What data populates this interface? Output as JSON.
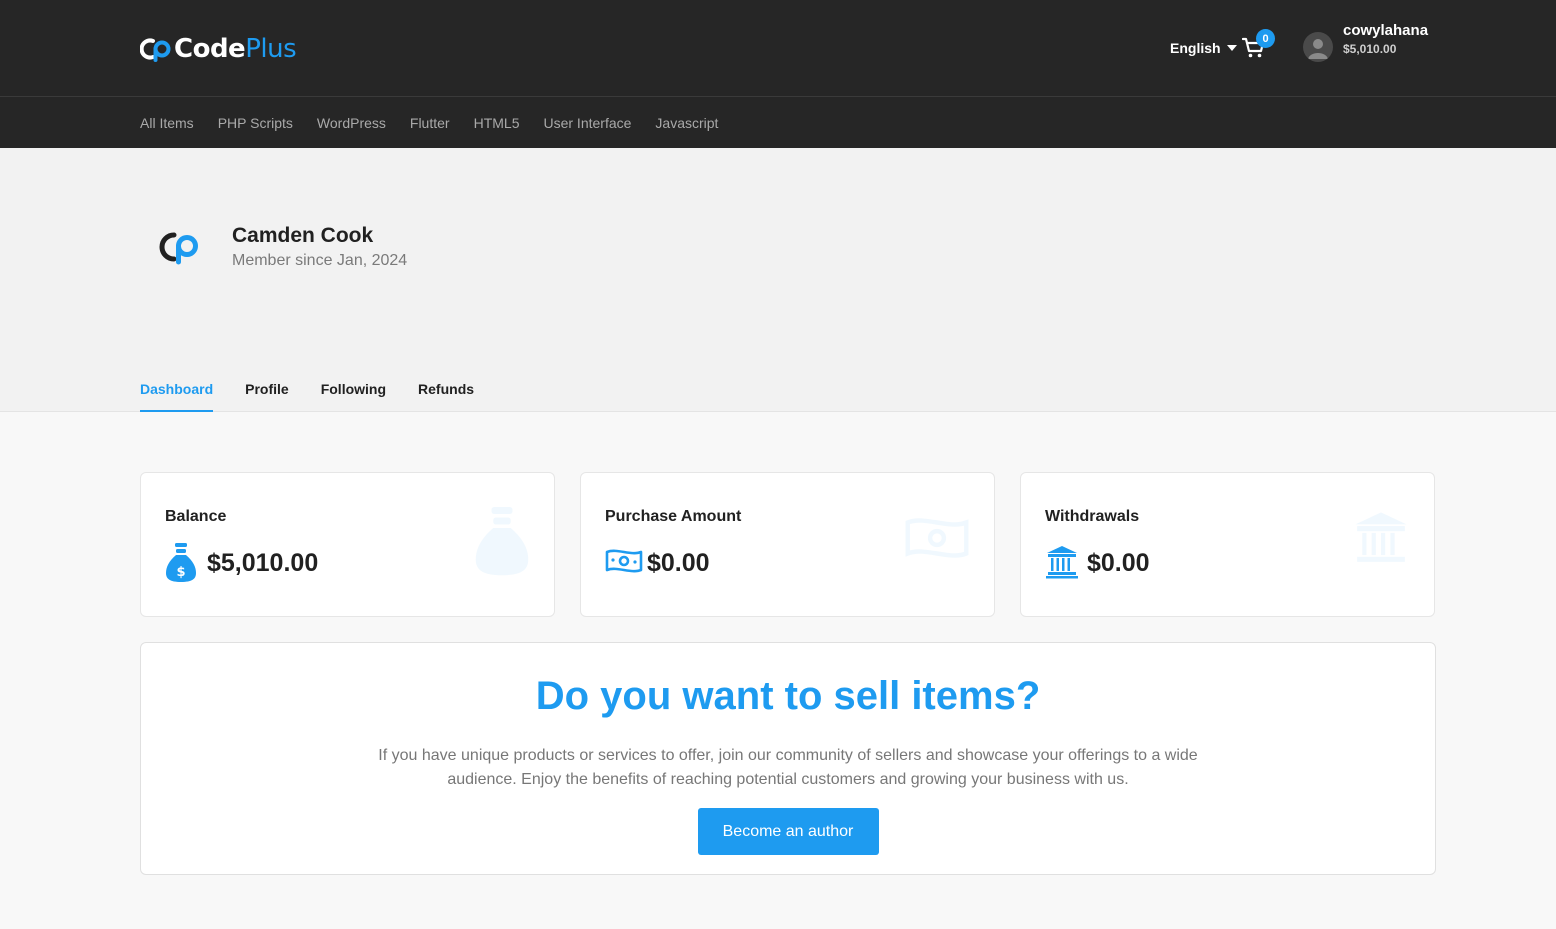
{
  "header": {
    "logo_code": "Code",
    "logo_plus": "Plus",
    "language": "English",
    "cart_count": "0",
    "user": {
      "name": "cowylahana",
      "balance": "$5,010.00"
    }
  },
  "categories": [
    "All Items",
    "PHP Scripts",
    "WordPress",
    "Flutter",
    "HTML5",
    "User Interface",
    "Javascript"
  ],
  "profile": {
    "name": "Camden Cook",
    "member_since": "Member since Jan, 2024"
  },
  "tabs": [
    {
      "label": "Dashboard",
      "active": true
    },
    {
      "label": "Profile",
      "active": false
    },
    {
      "label": "Following",
      "active": false
    },
    {
      "label": "Refunds",
      "active": false
    }
  ],
  "stats": [
    {
      "title": "Balance",
      "value": "$5,010.00",
      "icon": "money-bag-icon"
    },
    {
      "title": "Purchase Amount",
      "value": "$0.00",
      "icon": "cash-icon"
    },
    {
      "title": "Withdrawals",
      "value": "$0.00",
      "icon": "bank-icon"
    }
  ],
  "sell": {
    "title": "Do you want to sell items?",
    "description": "If you have unique products or services to offer, join our community of sellers and showcase your offerings to a wide audience. Enjoy the benefits of reaching potential customers and growing your business with us.",
    "button": "Become an author"
  },
  "colors": {
    "accent": "#1e9bf0",
    "topbar": "#262626"
  }
}
